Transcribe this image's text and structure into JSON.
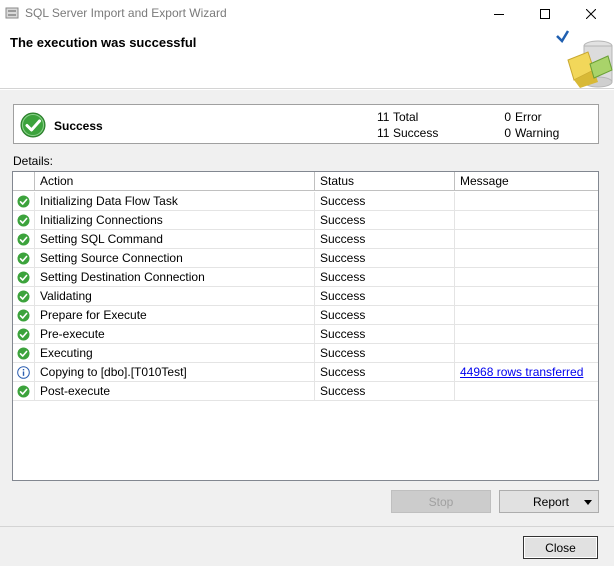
{
  "window": {
    "title": "SQL Server Import and Export Wizard",
    "icon": "wizard-app-icon"
  },
  "header": {
    "heading": "The execution was successful",
    "icon": "success-banner-icon"
  },
  "summary": {
    "status": "Success",
    "total_count": "11",
    "total_label": "Total",
    "success_count": "11",
    "success_label": "Success",
    "error_count": "0",
    "error_label": "Error",
    "warning_count": "0",
    "warning_label": "Warning"
  },
  "details": {
    "label": "Details:",
    "columns": [
      "Action",
      "Status",
      "Message"
    ],
    "rows": [
      {
        "icon": "success",
        "action": "Initializing Data Flow Task",
        "status": "Success",
        "message": ""
      },
      {
        "icon": "success",
        "action": "Initializing Connections",
        "status": "Success",
        "message": ""
      },
      {
        "icon": "success",
        "action": "Setting SQL Command",
        "status": "Success",
        "message": ""
      },
      {
        "icon": "success",
        "action": "Setting Source Connection",
        "status": "Success",
        "message": ""
      },
      {
        "icon": "success",
        "action": "Setting Destination Connection",
        "status": "Success",
        "message": ""
      },
      {
        "icon": "success",
        "action": "Validating",
        "status": "Success",
        "message": ""
      },
      {
        "icon": "success",
        "action": "Prepare for Execute",
        "status": "Success",
        "message": ""
      },
      {
        "icon": "success",
        "action": "Pre-execute",
        "status": "Success",
        "message": ""
      },
      {
        "icon": "success",
        "action": "Executing",
        "status": "Success",
        "message": ""
      },
      {
        "icon": "info",
        "action": "Copying to [dbo].[T010Test]",
        "status": "Success",
        "message": "44968 rows transferred"
      },
      {
        "icon": "success",
        "action": "Post-execute",
        "status": "Success",
        "message": ""
      }
    ]
  },
  "buttons": {
    "stop": "Stop",
    "report": "Report",
    "close": "Close"
  },
  "colors": {
    "success_green": "#3ca33c",
    "info_blue": "#2a5db0",
    "link": "#0000ee",
    "panel_bg": "#f0f0f0"
  }
}
